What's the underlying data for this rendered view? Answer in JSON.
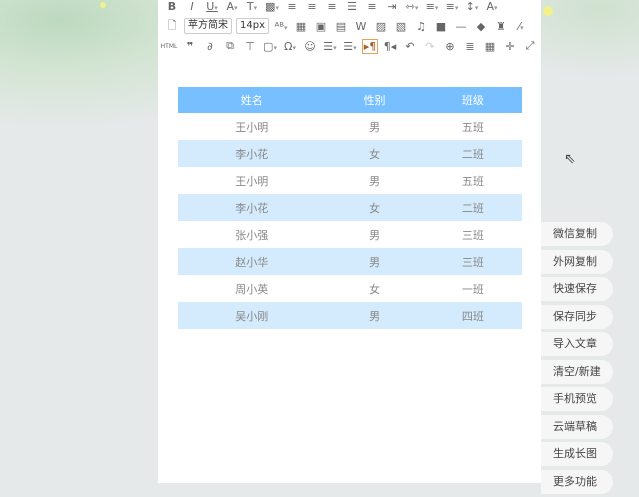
{
  "toolbar": {
    "font_family": "苹方简宋",
    "font_size": "14px",
    "html_label": "HTML"
  },
  "table": {
    "headers": [
      "姓名",
      "性别",
      "班级"
    ],
    "rows": [
      [
        "王小明",
        "男",
        "五班"
      ],
      [
        "李小花",
        "女",
        "二班"
      ],
      [
        "王小明",
        "男",
        "五班"
      ],
      [
        "李小花",
        "女",
        "二班"
      ],
      [
        "张小强",
        "男",
        "三班"
      ],
      [
        "赵小华",
        "男",
        "三班"
      ],
      [
        "周小英",
        "女",
        "一班"
      ],
      [
        "吴小刚",
        "男",
        "四班"
      ]
    ]
  },
  "side_buttons": [
    "微信复制",
    "外网复制",
    "快速保存",
    "保存同步",
    "导入文章",
    "清空/新建",
    "手机预览",
    "云端草稿",
    "生成长图",
    "更多功能"
  ],
  "colors": {
    "header": "#78bfff",
    "alt_row": "#d4eafd"
  }
}
